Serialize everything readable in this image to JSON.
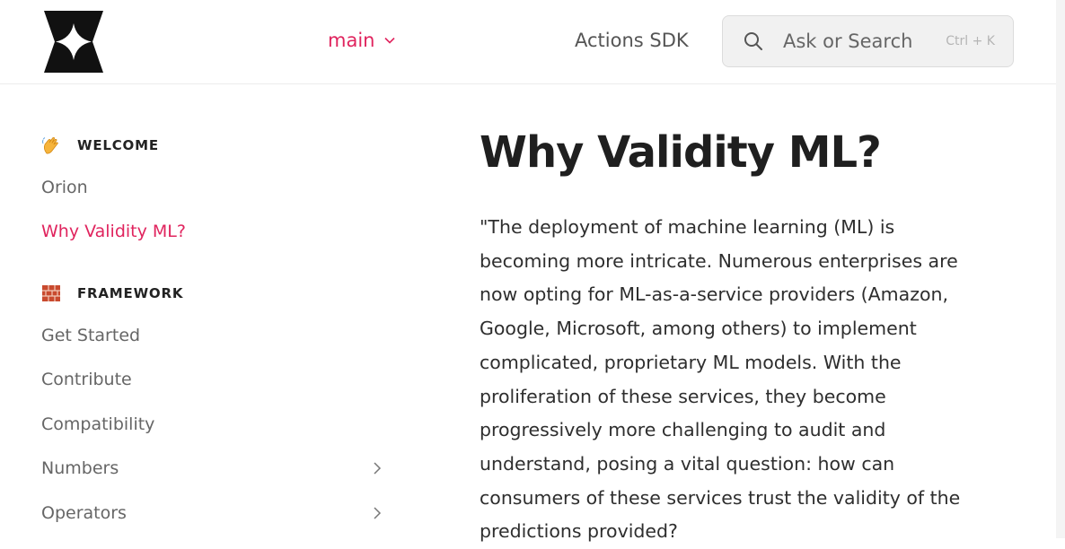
{
  "header": {
    "version_label": "main",
    "nav_link": "Actions SDK",
    "search_placeholder": "Ask or Search",
    "search_shortcut": "Ctrl + K"
  },
  "sidebar": {
    "sections": [
      {
        "title": "WELCOME",
        "icon": "waving-hand-icon",
        "items": [
          {
            "label": "Orion"
          },
          {
            "label": "Why Validity ML?",
            "active": true
          }
        ]
      },
      {
        "title": "FRAMEWORK",
        "icon": "brick-icon",
        "items": [
          {
            "label": "Get Started"
          },
          {
            "label": "Contribute"
          },
          {
            "label": "Compatibility"
          },
          {
            "label": "Numbers",
            "expandable": true
          },
          {
            "label": "Operators",
            "expandable": true
          }
        ]
      }
    ]
  },
  "page": {
    "title": "Why Validity ML?",
    "body": "\"The deployment of machine learning (ML) is becoming more intricate. Numerous enterprises are now opting for ML-as-a-service providers (Amazon, Google, Microsoft, among others) to implement complicated, proprietary ML models. With the proliferation of these services, they become progressively more challenging to audit and understand, posing a vital question: how can consumers of these services trust the validity of the predictions provided?"
  },
  "colors": {
    "accent": "#e0245e",
    "text": "#2e2e2e",
    "muted": "#666666"
  }
}
